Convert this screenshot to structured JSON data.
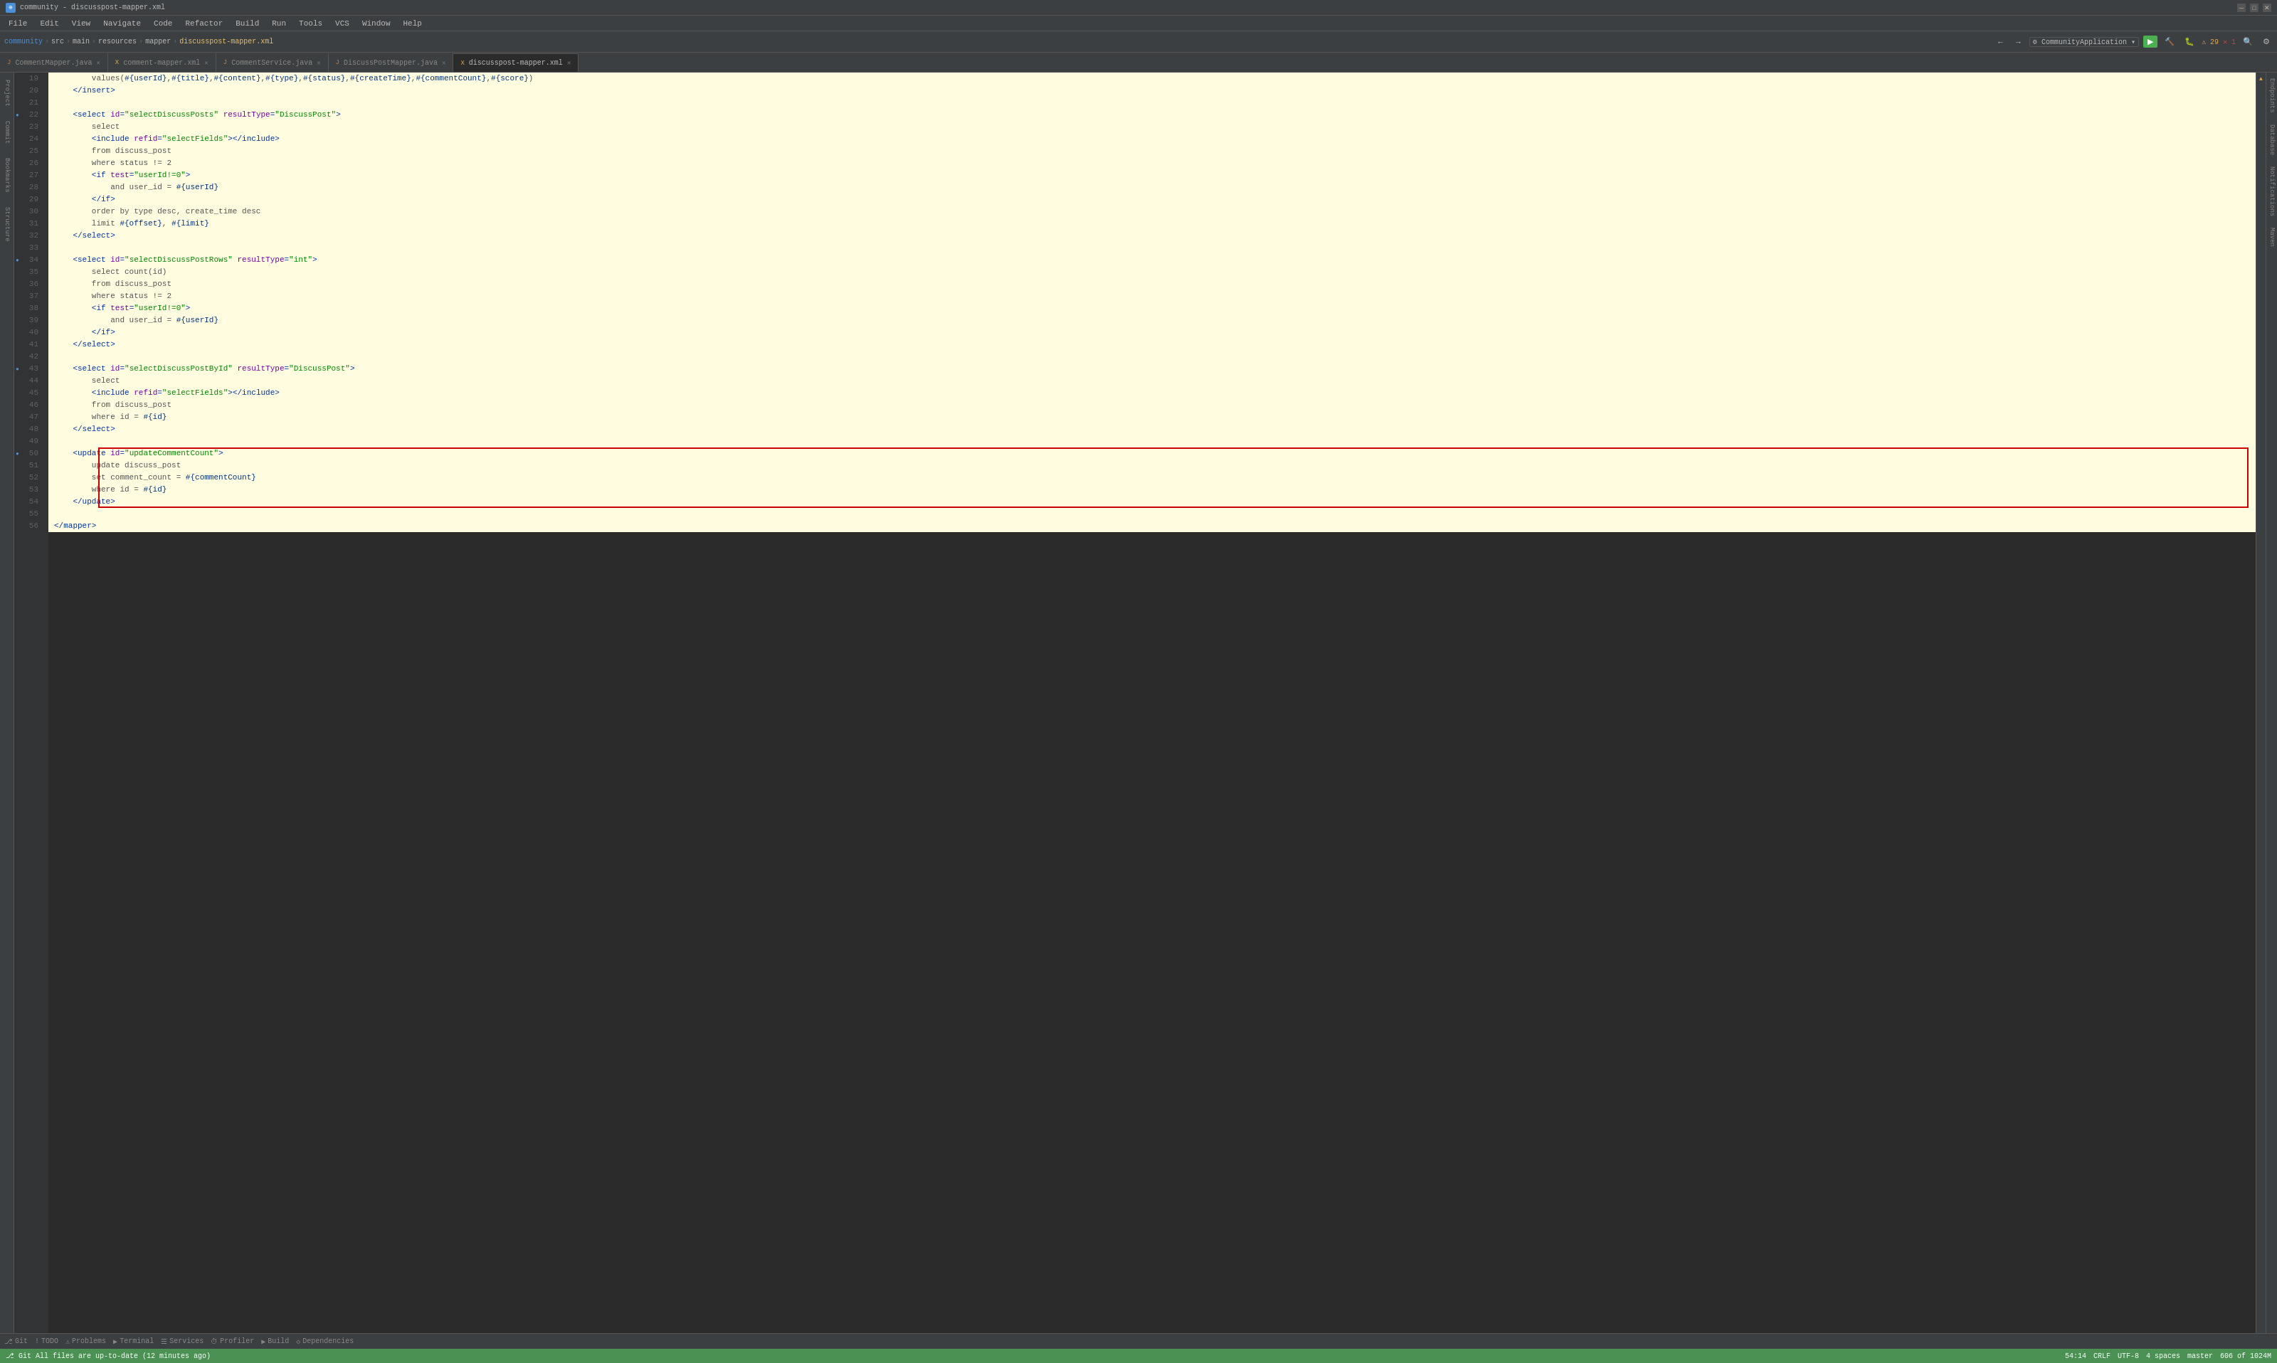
{
  "window": {
    "title": "community - discusspost-mapper.xml",
    "icon": "♦"
  },
  "menu": {
    "items": [
      "File",
      "Edit",
      "View",
      "Navigate",
      "Code",
      "Refactor",
      "Build",
      "Run",
      "Tools",
      "VCS",
      "Window",
      "Help"
    ]
  },
  "breadcrumb": {
    "items": [
      "community",
      "src",
      "main",
      "resources",
      "mapper",
      "discusspost-mapper.xml"
    ]
  },
  "tabs": [
    {
      "label": "CommentMapper.java",
      "type": "java",
      "active": false
    },
    {
      "label": "comment-mapper.xml",
      "type": "xml",
      "active": false
    },
    {
      "label": "CommentService.java",
      "type": "java",
      "active": false
    },
    {
      "label": "DiscussPostMapper.java",
      "type": "java",
      "active": false
    },
    {
      "label": "discusspost-mapper.xml",
      "type": "xml",
      "active": true
    }
  ],
  "run_config": "CommunityApplication",
  "warnings": {
    "count": "29",
    "errors": "1"
  },
  "editor": {
    "lines": [
      {
        "num": 19,
        "content": "        values(#{userId},#{title},#{content},#{type},#{status},#{createTime},#{commentCount},#{score})",
        "bg": "yellow"
      },
      {
        "num": 20,
        "content": "    </insert>",
        "bg": "yellow"
      },
      {
        "num": 21,
        "content": "",
        "bg": "yellow"
      },
      {
        "num": 22,
        "content": "    <select id=\"selectDiscussPosts\" resultType=\"DiscussPost\">",
        "bg": "yellow",
        "dot": true
      },
      {
        "num": 23,
        "content": "        select",
        "bg": "yellow"
      },
      {
        "num": 24,
        "content": "        <include refid=\"selectFields\"></include>",
        "bg": "yellow"
      },
      {
        "num": 25,
        "content": "        from discuss_post",
        "bg": "yellow"
      },
      {
        "num": 26,
        "content": "        where status != 2",
        "bg": "yellow"
      },
      {
        "num": 27,
        "content": "        <if test=\"userId!=0\">",
        "bg": "yellow"
      },
      {
        "num": 28,
        "content": "            and user_id = #{userId}",
        "bg": "yellow"
      },
      {
        "num": 29,
        "content": "        </if>",
        "bg": "yellow"
      },
      {
        "num": 30,
        "content": "        order by type desc, create_time desc",
        "bg": "yellow"
      },
      {
        "num": 31,
        "content": "        limit #{offset}, #{limit}",
        "bg": "yellow"
      },
      {
        "num": 32,
        "content": "    </select>",
        "bg": "yellow"
      },
      {
        "num": 33,
        "content": "",
        "bg": "yellow"
      },
      {
        "num": 34,
        "content": "    <select id=\"selectDiscussPostRows\" resultType=\"int\">",
        "bg": "yellow",
        "dot": true
      },
      {
        "num": 35,
        "content": "        select count(id)",
        "bg": "yellow"
      },
      {
        "num": 36,
        "content": "        from discuss_post",
        "bg": "yellow"
      },
      {
        "num": 37,
        "content": "        where status != 2",
        "bg": "yellow"
      },
      {
        "num": 38,
        "content": "        <if test=\"userId!=0\">",
        "bg": "yellow"
      },
      {
        "num": 39,
        "content": "            and user_id = #{userId}",
        "bg": "yellow"
      },
      {
        "num": 40,
        "content": "        </if>",
        "bg": "yellow"
      },
      {
        "num": 41,
        "content": "    </select>",
        "bg": "yellow"
      },
      {
        "num": 42,
        "content": "",
        "bg": "yellow"
      },
      {
        "num": 43,
        "content": "    <select id=\"selectDiscussPostById\" resultType=\"DiscussPost\">",
        "bg": "yellow",
        "dot": true
      },
      {
        "num": 44,
        "content": "        select",
        "bg": "yellow"
      },
      {
        "num": 45,
        "content": "        <include refid=\"selectFields\"></include>",
        "bg": "yellow"
      },
      {
        "num": 46,
        "content": "        from discuss_post",
        "bg": "yellow"
      },
      {
        "num": 47,
        "content": "        where id = #{id}",
        "bg": "yellow"
      },
      {
        "num": 48,
        "content": "    </select>",
        "bg": "yellow"
      },
      {
        "num": 49,
        "content": "",
        "bg": "yellow"
      },
      {
        "num": 50,
        "content": "    <update id=\"updateCommentCount\">",
        "bg": "yellow",
        "dot": true,
        "redBox": "top"
      },
      {
        "num": 51,
        "content": "        update discuss_post",
        "bg": "yellow",
        "redBox": "middle"
      },
      {
        "num": 52,
        "content": "        set comment_count = #{commentCount}",
        "bg": "yellow",
        "redBox": "middle"
      },
      {
        "num": 53,
        "content": "        where id = #{id}",
        "bg": "yellow",
        "redBox": "middle"
      },
      {
        "num": 54,
        "content": "    </update>",
        "bg": "yellow",
        "redBox": "bottom"
      },
      {
        "num": 55,
        "content": "",
        "bg": "yellow"
      },
      {
        "num": 56,
        "content": "</mapper>",
        "bg": "yellow"
      }
    ]
  },
  "bottom_tabs": [
    {
      "icon": "⎇",
      "label": "Git"
    },
    {
      "icon": "!",
      "label": "TODO"
    },
    {
      "icon": "⚠",
      "label": "Problems"
    },
    {
      "icon": "▶",
      "label": "Terminal"
    },
    {
      "icon": "☰",
      "label": "Services"
    },
    {
      "icon": "⏱",
      "label": "Profiler"
    },
    {
      "icon": "▶",
      "label": "Build"
    },
    {
      "icon": "◇",
      "label": "Dependencies"
    }
  ],
  "status": {
    "message": "All files are up-to-date (12 minutes ago)",
    "position": "54:14",
    "encoding": "CRLF",
    "charset": "UTF-8",
    "indent": "4 spaces",
    "vcs": "master",
    "mem": "606 of 1024M"
  },
  "right_panels": [
    "Endpoints",
    "Database",
    "Notifications",
    "Maven"
  ],
  "left_panels": [
    "Project",
    "Commit",
    "Bookmarks",
    "Structure"
  ]
}
